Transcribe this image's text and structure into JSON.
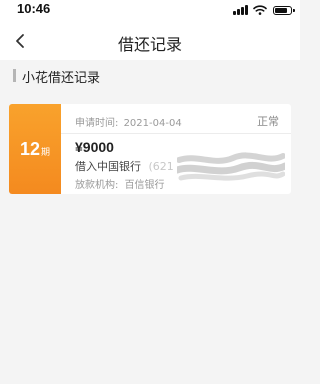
{
  "status_bar": {
    "time": "10:46"
  },
  "nav": {
    "title": "借还记录"
  },
  "section": {
    "title": "小花借还记录"
  },
  "record": {
    "term_number": "12",
    "term_unit": "期",
    "apply_label": "申请时间:",
    "apply_date": "2021-04-04",
    "status": "正常",
    "amount": "¥9000",
    "borrow_label": "借入中国银行",
    "card_prefix": "(621",
    "lender_label": "放款机构:",
    "lender_name": "百信银行"
  },
  "colors": {
    "badge_orange": "#f59426",
    "background": "#f4f4f4"
  }
}
